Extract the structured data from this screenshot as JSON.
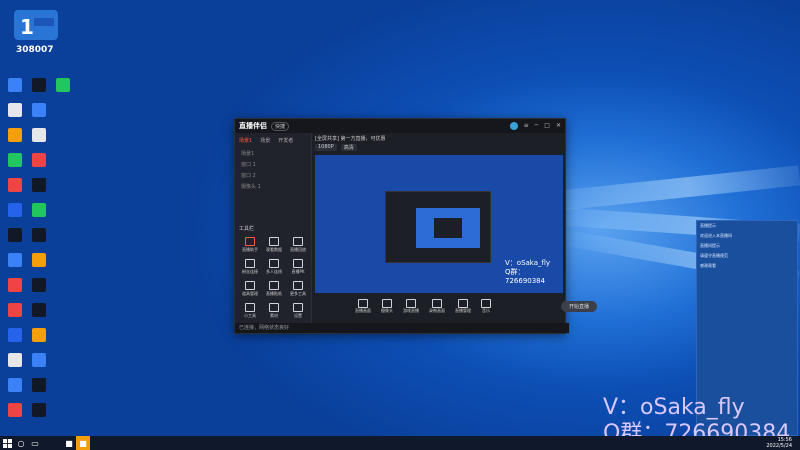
{
  "desktop": {
    "left_col": [
      {
        "label": "",
        "color": "#3b82f6"
      },
      {
        "label": "",
        "color": "#e5e7eb"
      },
      {
        "label": "",
        "color": "#f59e0b"
      },
      {
        "label": "",
        "color": "#22c55e"
      },
      {
        "label": "",
        "color": "#ef4444"
      },
      {
        "label": "",
        "color": "#2563eb"
      },
      {
        "label": "",
        "color": "#111827"
      },
      {
        "label": "",
        "color": "#3b82f6"
      },
      {
        "label": "",
        "color": "#ef4444"
      },
      {
        "label": "",
        "color": "#ef4444"
      },
      {
        "label": "",
        "color": "#2563eb"
      },
      {
        "label": "",
        "color": "#e5e7eb"
      },
      {
        "label": "",
        "color": "#3b82f6"
      },
      {
        "label": "",
        "color": "#ef4444"
      }
    ],
    "right_col": [
      {
        "label": "",
        "color": "#111827"
      },
      {
        "label": "",
        "color": "#3b82f6"
      },
      {
        "label": "",
        "color": "#e5e7eb"
      },
      {
        "label": "",
        "color": "#ef4444"
      },
      {
        "label": "",
        "color": "#111827"
      },
      {
        "label": "",
        "color": "#22c55e"
      },
      {
        "label": "",
        "color": "#111827"
      },
      {
        "label": "",
        "color": "#f59e0b"
      },
      {
        "label": "",
        "color": "#111827"
      },
      {
        "label": "",
        "color": "#111827"
      },
      {
        "label": "",
        "color": "#f59e0b"
      },
      {
        "label": "",
        "color": "#3b82f6"
      },
      {
        "label": "",
        "color": "#111827"
      },
      {
        "label": "",
        "color": "#111827"
      }
    ],
    "third_col": [
      {
        "label": "",
        "color": "#22c55e"
      }
    ]
  },
  "logo": {
    "number": "308007"
  },
  "app": {
    "brand": "直播伴侣",
    "badge": "快捷",
    "left_tabs": [
      "场景1",
      "场景",
      "开发者"
    ],
    "scenes": [
      "场景1",
      "窗口 1",
      "窗口 2",
      "摄像头 1"
    ],
    "tools_title": "工具栏",
    "tools": [
      "直播助手",
      "观看数据",
      "直播回放",
      "粉丝连接",
      "多人连线",
      "直播PK",
      "道具管理",
      "直播贴纸",
      "更多工具",
      "小工具",
      "素材",
      "设置"
    ],
    "status": "已连接，网络状态良好",
    "header_text": "[全屏共享] 第一方直播，可优惠",
    "bottom_items": [
      "直播画面",
      "摄像头",
      "游戏直播",
      "录制画面",
      "直播管理",
      "音乐"
    ],
    "go_live": "开始直播",
    "watermark_line1": "V：oSaka_fly",
    "watermark_line2": "Q群：726690384"
  },
  "right_panel": {
    "header": "直播提示",
    "items": [
      "欢迎进入本直播间",
      "直播间提示",
      "请遵守直播规范",
      "感谢观看"
    ]
  },
  "watermark": {
    "line1": "V：oSaka_fly",
    "line2": "Q群：726690384"
  },
  "taskbar": {
    "time": "15:56",
    "date": "2022/5/24"
  }
}
